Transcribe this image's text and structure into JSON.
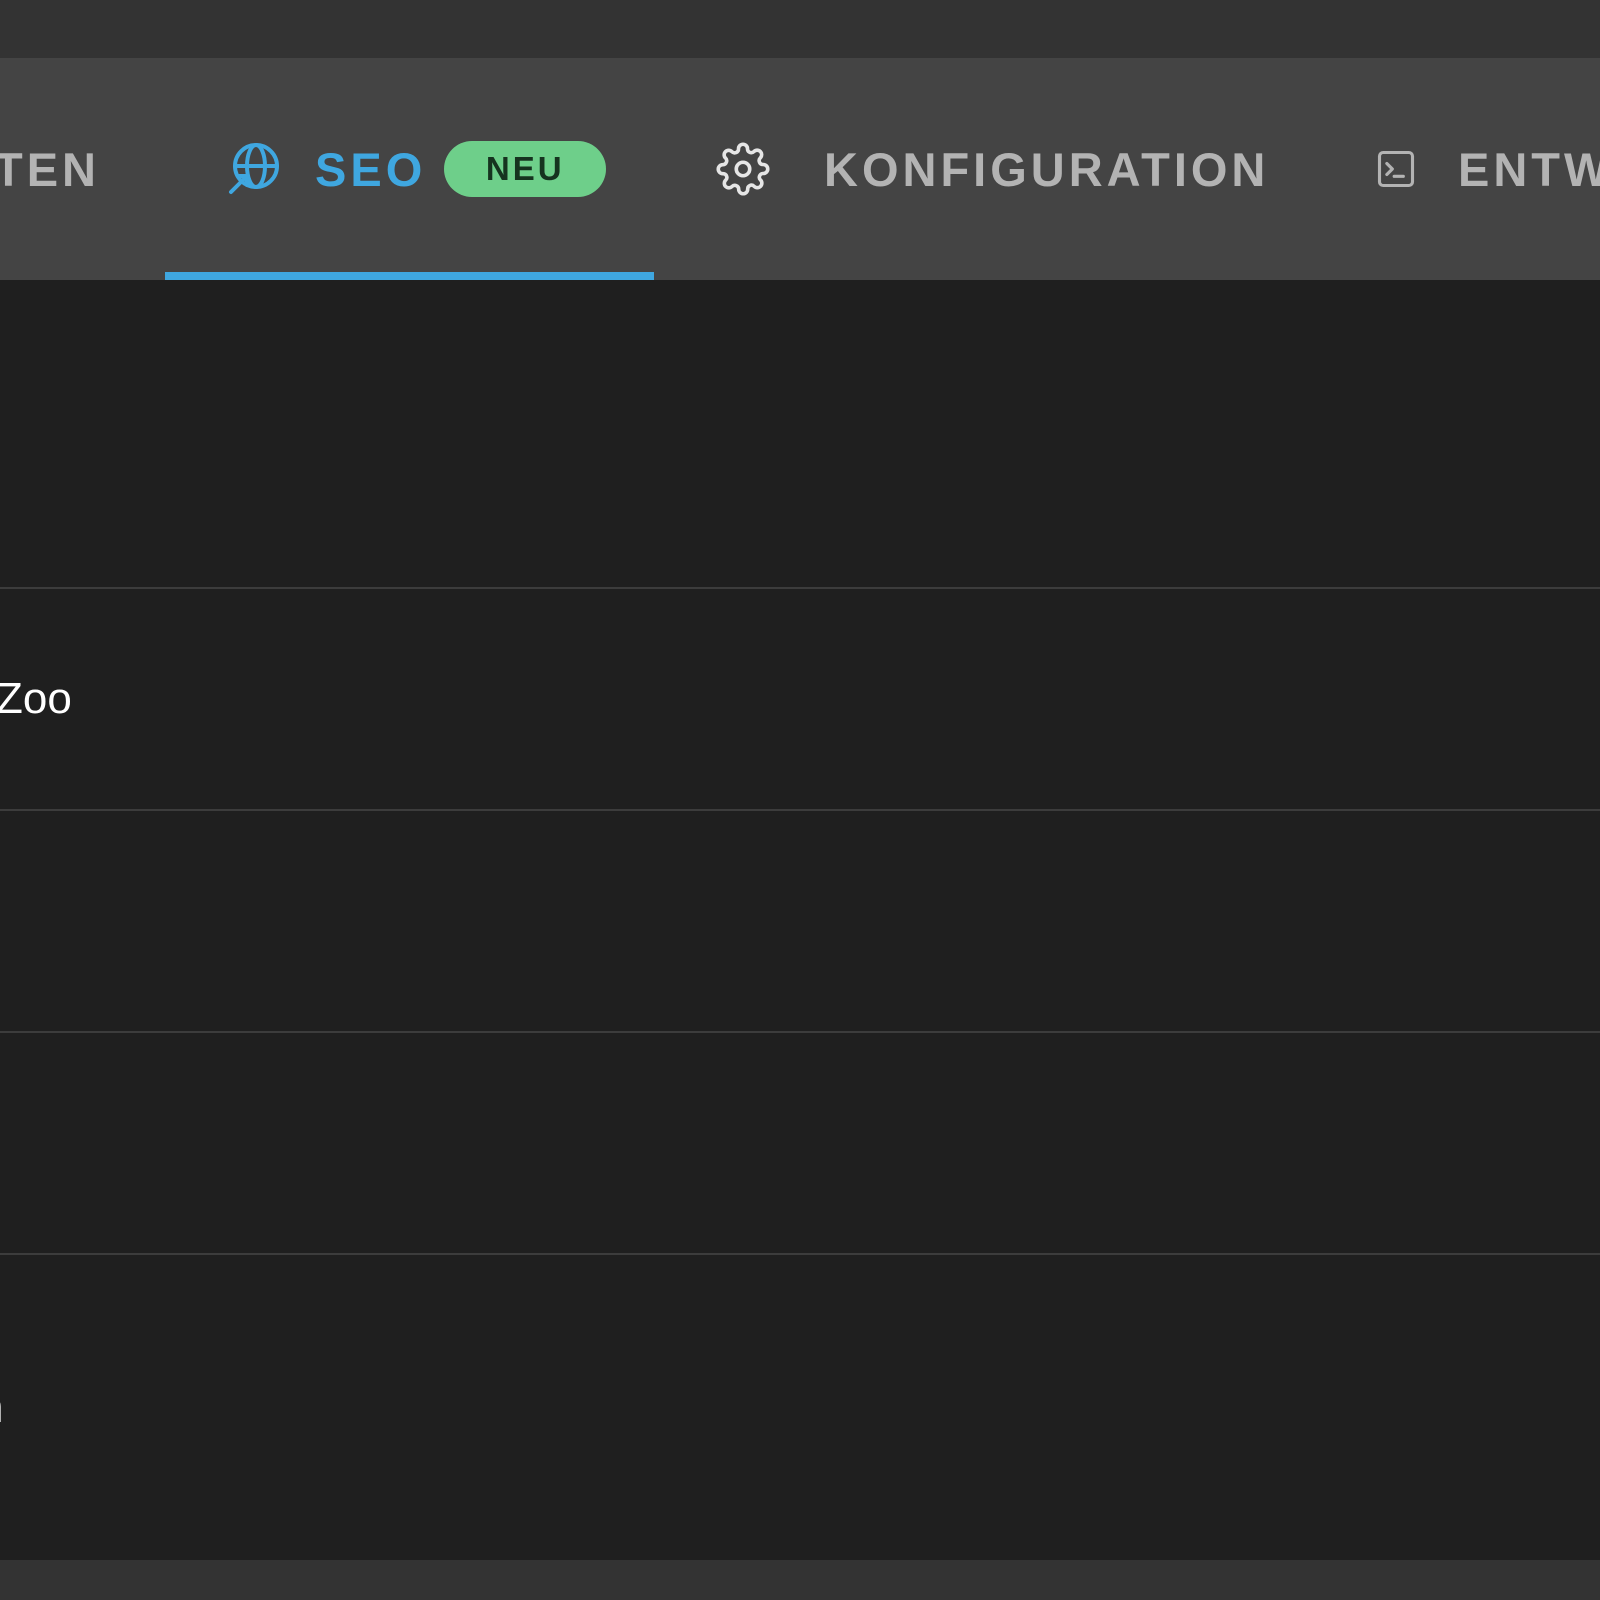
{
  "colors": {
    "accent": "#3fa7e0",
    "badge_bg": "#6ecf8a",
    "badge_text": "#16331f",
    "tab_inactive": "#b3b3b3",
    "row_text": "#ffffff"
  },
  "tabs": [
    {
      "label": "TEN",
      "icon": null,
      "active": false
    },
    {
      "label": "SEO",
      "icon": "globe-rocket-icon",
      "active": true,
      "badge": "NEU"
    },
    {
      "label": "KONFIGURATION",
      "icon": "gear-icon",
      "active": false
    },
    {
      "label": "ENTW",
      "icon": "terminal-icon",
      "active": false
    }
  ],
  "rows": [
    {
      "text": ""
    },
    {
      "text": "Zoo"
    },
    {
      "text": ""
    },
    {
      "text": ""
    },
    {
      "text": "n"
    }
  ]
}
